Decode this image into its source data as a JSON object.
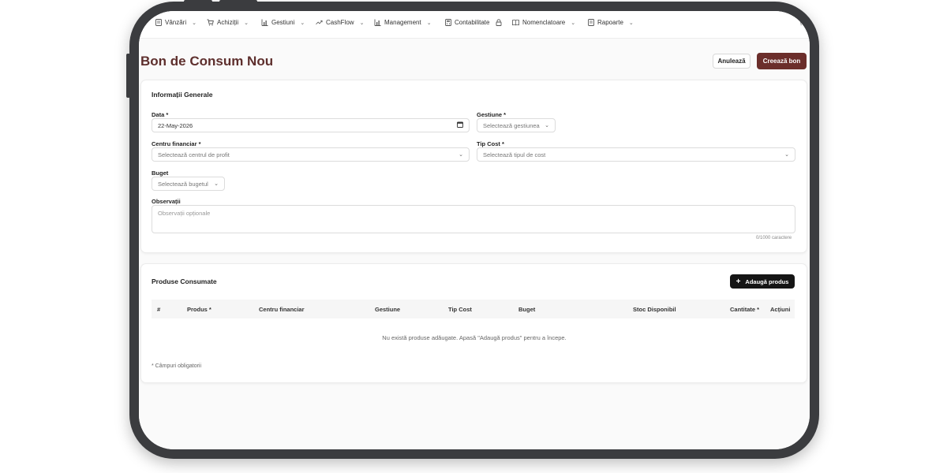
{
  "nav": {
    "items": [
      {
        "label": "Vânzări",
        "icon": "document-icon",
        "chevron": true
      },
      {
        "label": "Achiziții",
        "icon": "cart-icon",
        "chevron": true
      },
      {
        "label": "Gestiuni",
        "icon": "bar-chart-icon",
        "chevron": true
      },
      {
        "label": "CashFlow",
        "icon": "trend-icon",
        "chevron": true
      },
      {
        "label": "Management",
        "icon": "bar-chart-icon",
        "chevron": true
      },
      {
        "label": "Contabilitate",
        "icon": "calculator-icon",
        "lock": true
      },
      {
        "label": "Nomenclatoare",
        "icon": "book-icon",
        "chevron": true
      },
      {
        "label": "Rapoarte",
        "icon": "document-icon",
        "chevron": true
      }
    ]
  },
  "header": {
    "title": "Bon de Consum Nou",
    "cancel_label": "Anulează",
    "create_label": "Creează bon"
  },
  "general": {
    "title": "Informații Generale",
    "data_label": "Data *",
    "data_value": "22-May-2026",
    "gestiune_label": "Gestiune *",
    "gestiune_placeholder": "Selectează gestiunea",
    "centru_label": "Centru financiar *",
    "centru_placeholder": "Selectează centrul de profit",
    "tipcost_label": "Tip Cost *",
    "tipcost_placeholder": "Selectează tipul de cost",
    "buget_label": "Buget",
    "buget_placeholder": "Selectează bugetul",
    "observatii_label": "Observații",
    "observatii_placeholder": "Observații opționale",
    "counter": "0/1000 caractere"
  },
  "products": {
    "title": "Produse Consumate",
    "add_label": "Adaugă produs",
    "columns": [
      "#",
      "Produs *",
      "Centru financiar",
      "Gestiune",
      "Tip Cost",
      "Buget",
      "Stoc Disponibil",
      "Cantitate *",
      "Acțiuni"
    ],
    "empty_text": "Nu există produse adăugate. Apasă \"Adaugă produs\" pentru a începe.",
    "required_note": "* Câmpuri obligatorii"
  },
  "colors": {
    "accent": "#6b2e2b",
    "title": "#5e2f2d",
    "dark_button": "#151515"
  }
}
